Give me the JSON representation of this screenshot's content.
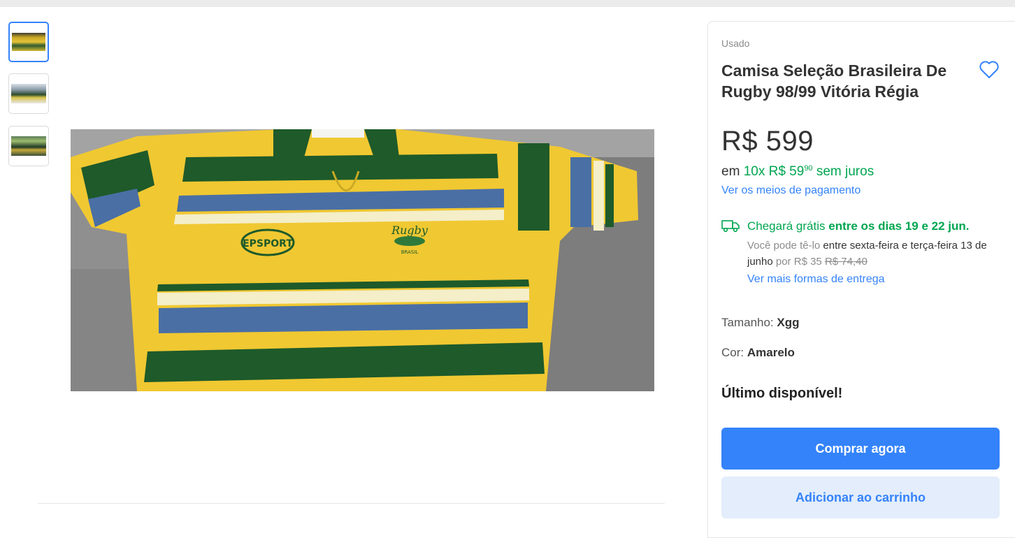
{
  "gallery": {
    "thumbnails": [
      "thumbnail-1",
      "thumbnail-2",
      "thumbnail-3"
    ],
    "selected_index": 0
  },
  "product": {
    "condition": "Usado",
    "title": "Camisa Seleção Brasileira De Rugby 98/99 Vitória Régia",
    "price": "R$ 599",
    "installments_prefix": "em",
    "installments_count": "10x",
    "installments_value": "R$ 59",
    "installments_cents": "90",
    "installments_suffix": "sem juros",
    "payment_link": "Ver os meios de pagamento"
  },
  "shipping": {
    "free_label": "Chegará grátis",
    "free_dates": "entre os dias 19 e 22 jun.",
    "alt_prefix": "Você pode tê-lo",
    "alt_dates": "entre sexta-feira e terça-feira 13 de junho",
    "alt_por": "por",
    "alt_price": "R$ 35",
    "alt_old_price": "R$ 74,40",
    "more_link": "Ver mais formas de entrega"
  },
  "attributes": {
    "size_label": "Tamanho:",
    "size_value": "Xgg",
    "color_label": "Cor:",
    "color_value": "Amarelo"
  },
  "stock": {
    "message": "Último disponível!"
  },
  "actions": {
    "buy_now": "Comprar agora",
    "add_to_cart": "Adicionar ao carrinho"
  },
  "photo": {
    "logo_left": "EPSPORT",
    "logo_right_top": "Rugby",
    "logo_right_bottom": "BRASIL"
  },
  "colors": {
    "accent": "#3483fa",
    "success": "#00a650",
    "shirt_yellow": "#f0c832",
    "shirt_green": "#1e5a2a",
    "shirt_blue": "#4a6fa5"
  },
  "icons": [
    "heart-icon",
    "truck-icon"
  ]
}
